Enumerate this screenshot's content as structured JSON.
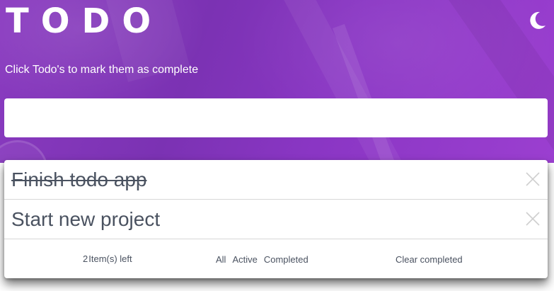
{
  "header": {
    "title": "TODO",
    "theme_toggle_icon": "moon-icon"
  },
  "instructions": "Click Todo's to mark them as complete",
  "new_todo": {
    "placeholder": "",
    "value": ""
  },
  "todos": [
    {
      "text": "Finish todo app",
      "completed": true
    },
    {
      "text": "Start new project",
      "completed": false
    }
  ],
  "footer": {
    "items_left_count": "2",
    "items_left_label": "Item(s) left",
    "filters": [
      "All",
      "Active",
      "Completed"
    ],
    "clear_completed_label": "Clear completed"
  },
  "colors": {
    "accent": "#8a3bc0",
    "text": "#4a5260",
    "card": "#ffffff"
  }
}
